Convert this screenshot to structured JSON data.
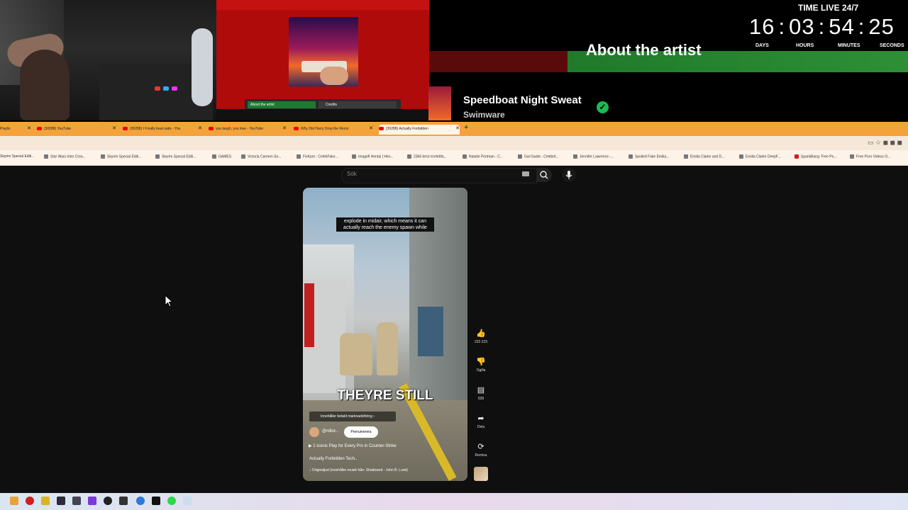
{
  "overlay": {
    "clock_title": "TIME LIVE 24/7",
    "days": "16",
    "hours": "03",
    "minutes": "54",
    "seconds": "25",
    "label_days": "DAYS",
    "label_hours": "HOURS",
    "label_minutes": "MINUTES",
    "label_seconds": "SECONDS",
    "about": "About the artist",
    "track": "Speedboat Night Sweat",
    "artist": "Swimware",
    "music_tab1": "About the artist",
    "music_tab2": "Credits"
  },
  "tabs": [
    {
      "label": "Playlis",
      "active": false
    },
    {
      "label": "(30288) YouTube",
      "active": false
    },
    {
      "label": "(30288) I Finally beat satis - You",
      "active": false
    },
    {
      "label": "you laugh, you lose - YouTube",
      "active": false
    },
    {
      "label": "Why Did Harry Drop the Recor",
      "active": false
    },
    {
      "label": "(30288) Actually Forbidden",
      "active": true
    }
  ],
  "bookmarks": [
    "Skyrim Special Editi...",
    "Star Wars Intro Crea...",
    "Skyrim Special Editi...",
    "Skyrim Special Editi...",
    "GAMES",
    "Victoria Carmen So...",
    "FixKpro : CelebFake...",
    "Imagefi Hentai | Hen...",
    "2366 best r/celebfa...",
    "Natalie Portman - C...",
    "Gal Gadot - Celebrit...",
    "Jennifer Lawrence -...",
    "Spoiled Fake Emilia...",
    "Emilia Clarke and D...",
    "Emilia Clarke DeepF...",
    "SpankBang: Free Po...",
    "Free Porn Videos O..."
  ],
  "youtube": {
    "search_placeholder": "Sök",
    "caption": "explode in midair, which means it can actually reach the enemy spawn while",
    "big_text": "THEYRE STILL",
    "promo": "Innehåller betald marknadsföring",
    "channel": "@nilloc..",
    "subscribe": "Prenumerera",
    "playlist": "1 Iconic Play for Every Pro in Counter-Strike",
    "description": "Actually Forbidden Tech..",
    "audio": "Originaljud (innehåller musik från: Shadowed - John B. Lund)",
    "like_count": "222 223",
    "dislike_label": "Ogilla",
    "comment_count": "939",
    "share_label": "Dela",
    "remix_label": "Remixa"
  }
}
